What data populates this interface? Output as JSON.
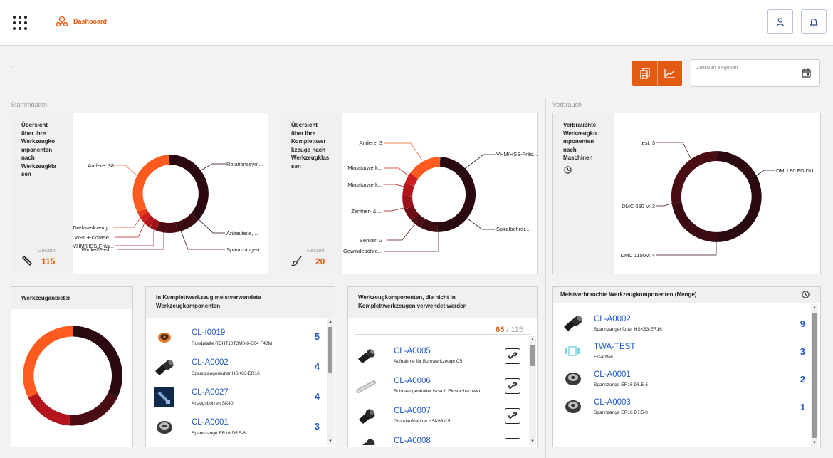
{
  "header": {
    "breadcrumb": "Dashboard"
  },
  "toolbar": {
    "date_placeholder": "Zeitraum eingeben"
  },
  "sections": {
    "stammdaten": "Stammdaten",
    "verbrauch": "Verbrauch"
  },
  "colors": {
    "accent": "#e35a12",
    "link": "#1f57c3",
    "ring_dark": "#2a0a10",
    "ring_maroon": "#4a0d14",
    "ring_red": "#b2161c",
    "ring_orange": "#ff5a1f"
  },
  "card1": {
    "title_lines": [
      "Übersicht",
      "über Ihre",
      "Werkzeugko",
      "mponenten",
      "nach",
      "Werkzeugkla",
      "sen"
    ],
    "gesamt_label": "Gesamt",
    "total": "115",
    "icon": "tool-icon",
    "labels": [
      "Rotationssym...",
      "Anbauteile, ...",
      "Spannzangen ...",
      "Winkel/Fasfr...",
      "VHM/HSS-Fräs...",
      "WPL-Eckfräse...",
      "Drehwerkzeug...",
      "Andere: 38"
    ]
  },
  "card2": {
    "title_lines": [
      "Übersicht",
      "über Ihre",
      "Komplettwer",
      "kzeuge nach",
      "Werkzeugklas",
      "sen"
    ],
    "gesamt_label": "Gesamt",
    "total": "20",
    "icon": "brush-tool-icon",
    "labels": [
      "VHM/HSS-Fräs...",
      "Spiralbohrer...",
      "Gewindebohre...",
      "Senker: 2",
      "Zentrier- & ...",
      "Miniaturwerk...",
      "Miniaturwerk...",
      "Andere: 3"
    ]
  },
  "card3": {
    "title_lines": [
      "Verbrauchte",
      "Werkzeugko",
      "mponenten",
      "nach",
      "Maschinen"
    ],
    "icon": "clock-icon",
    "labels": [
      "DMU 80 FD DU...",
      "DMC 1150V: 4",
      "DMC 650 V: 3",
      "test: 3"
    ]
  },
  "card4": {
    "title": "Werkzeuganbieter"
  },
  "card5": {
    "title_lines": [
      "In Komplettwerkzeug meistverwendete",
      "Werkzeugkomponenten"
    ],
    "items": [
      {
        "code": "CL-I0019",
        "desc": "Rundplatte RDHT10T3M0-8-E04 F40M",
        "count": "5",
        "icon": "insert-icon"
      },
      {
        "code": "CL-A0002",
        "desc": "Spannzangenfutter HSK63-ER16",
        "count": "4",
        "icon": "collet-chuck-icon"
      },
      {
        "code": "CL-A0027",
        "desc": "Anzugsbolzen SK40",
        "count": "4",
        "icon": "pull-stud-icon"
      },
      {
        "code": "CL-A0001",
        "desc": "Spannzange ER16 D5.5-6",
        "count": "3",
        "icon": "collet-icon"
      }
    ]
  },
  "card6": {
    "title_lines": [
      "Werkzeugkomponenten, die nicht in",
      "Komplettwerkzeugen verwendet werden"
    ],
    "count_current": "65",
    "count_sep": "/",
    "count_total": "115",
    "items": [
      {
        "code": "CL-A0005",
        "desc": "Aufnahme für Bohrwerkzeuge C5",
        "icon": "holder-icon"
      },
      {
        "code": "CL-A0006",
        "desc": "Bohrstangenhalter Iscar f. Einstechschwert",
        "icon": "bar-holder-icon"
      },
      {
        "code": "CL-A0007",
        "desc": "Grundaufnahme HSK63 C5",
        "icon": "base-holder-icon"
      },
      {
        "code": "CL-A0008",
        "desc": "",
        "icon": "holder-icon"
      }
    ]
  },
  "card7": {
    "title": "Meistverbrauchte Werkzeugkomponenten (Menge)",
    "icon": "clock-icon",
    "items": [
      {
        "code": "CL-A0002",
        "desc": "Spannzangenfutter HSK63-ER16",
        "count": "9",
        "icon": "collet-chuck-icon"
      },
      {
        "code": "TWA-TEST",
        "desc": "Ersatzteil",
        "count": "3",
        "icon": "spare-part-icon"
      },
      {
        "code": "CL-A0001",
        "desc": "Spannzange ER16 D5.5-6",
        "count": "2",
        "icon": "collet-icon"
      },
      {
        "code": "CL-A0003",
        "desc": "Spannzange ER16 D7.5-8",
        "count": "1",
        "icon": "collet-icon"
      }
    ]
  }
}
